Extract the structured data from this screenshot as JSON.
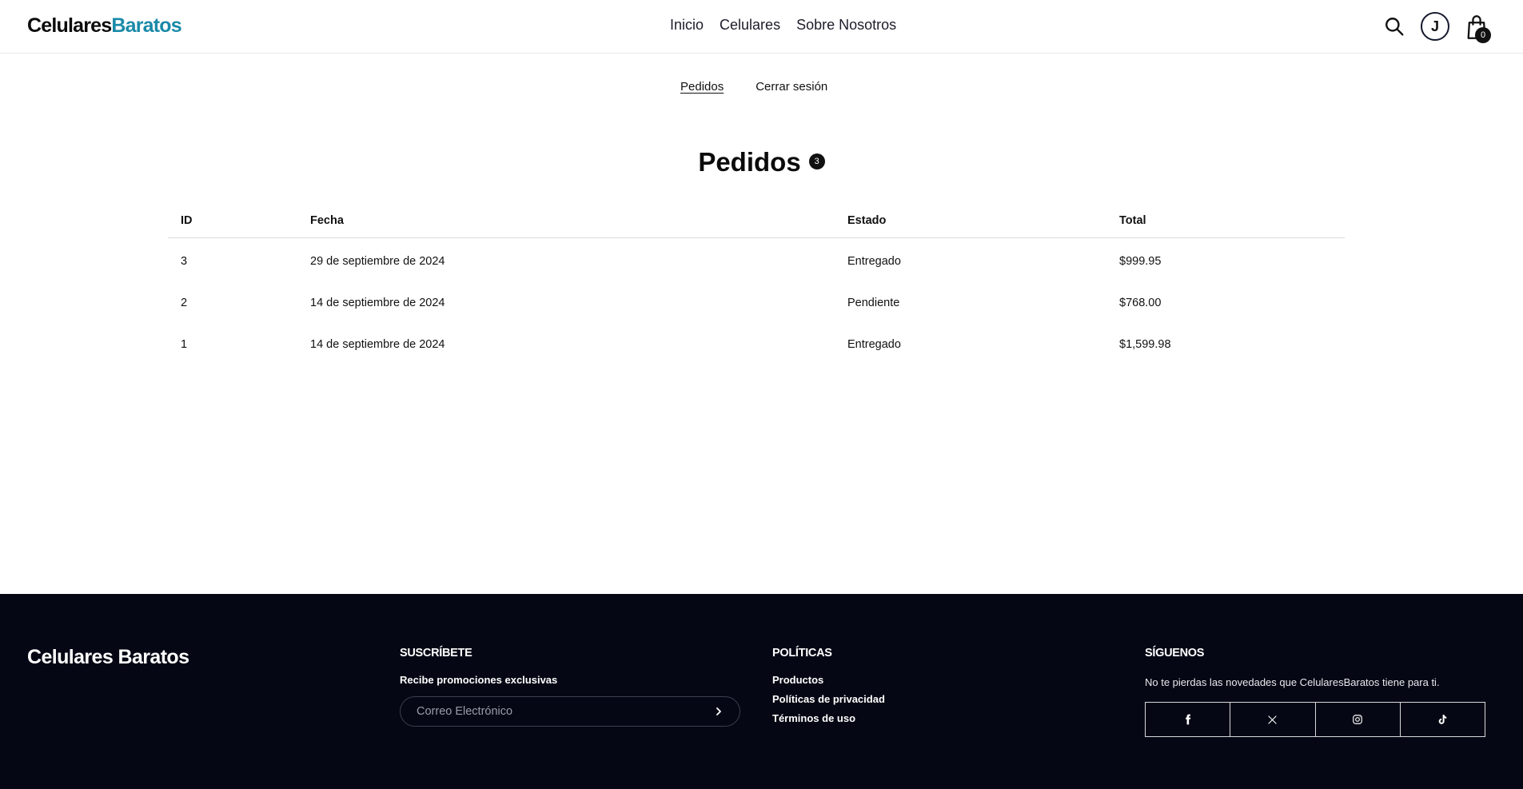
{
  "header": {
    "logo_part1": "Celulares",
    "logo_part2": "Baratos",
    "nav": [
      "Inicio",
      "Celulares",
      "Sobre Nosotros"
    ],
    "avatar_initial": "J",
    "cart_count": "0"
  },
  "account_nav": {
    "orders": "Pedidos",
    "logout": "Cerrar sesión"
  },
  "main": {
    "title": "Pedidos",
    "title_count": "3",
    "columns": [
      "ID",
      "Fecha",
      "Estado",
      "Total"
    ],
    "rows": [
      {
        "id": "3",
        "fecha": "29 de septiembre de 2024",
        "estado": "Entregado",
        "total": "$999.95"
      },
      {
        "id": "2",
        "fecha": "14 de septiembre de 2024",
        "estado": "Pendiente",
        "total": "$768.00"
      },
      {
        "id": "1",
        "fecha": "14 de septiembre de 2024",
        "estado": "Entregado",
        "total": "$1,599.98"
      }
    ]
  },
  "footer": {
    "logo": "Celulares Baratos",
    "subscribe": {
      "heading": "SUSCRÍBETE",
      "subheading": "Recibe promociones exclusivas",
      "email_placeholder": "Correo Electrónico"
    },
    "policies": {
      "heading": "POLÍTICAS",
      "links": [
        "Productos",
        "Políticas de privacidad",
        "Términos de uso"
      ]
    },
    "follow": {
      "heading": "SÍGUENOS",
      "text": "No te pierdas las novedades que CelularesBaratos tiene para ti.",
      "icons": [
        "facebook-icon",
        "x-icon",
        "instagram-icon",
        "tiktok-icon"
      ]
    }
  },
  "colors": {
    "brand_accent": "#1a8aa8",
    "footer_bg": "#050814"
  }
}
